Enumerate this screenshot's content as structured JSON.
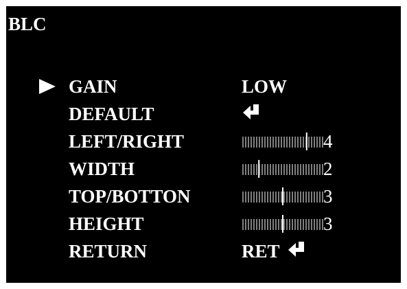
{
  "menu": {
    "title": "BLC",
    "rows": [
      {
        "label": "GAIN",
        "value": "LOW",
        "selected": true
      },
      {
        "label": "DEFAULT",
        "icon": "enter-icon"
      },
      {
        "label": "LEFT/RIGHT",
        "level": 4,
        "level_max": 5
      },
      {
        "label": "WIDTH",
        "level": 2,
        "level_max": 10
      },
      {
        "label": "TOP/BOTTON",
        "level": 3,
        "level_max": 6
      },
      {
        "label": "HEIGHT",
        "level": 3,
        "level_max": 6
      },
      {
        "label": "RETURN",
        "value": "RET",
        "icon": "enter-icon"
      }
    ]
  },
  "colors": {
    "background": "#000000",
    "text": "#ffffff",
    "frame": "#ffffff"
  }
}
